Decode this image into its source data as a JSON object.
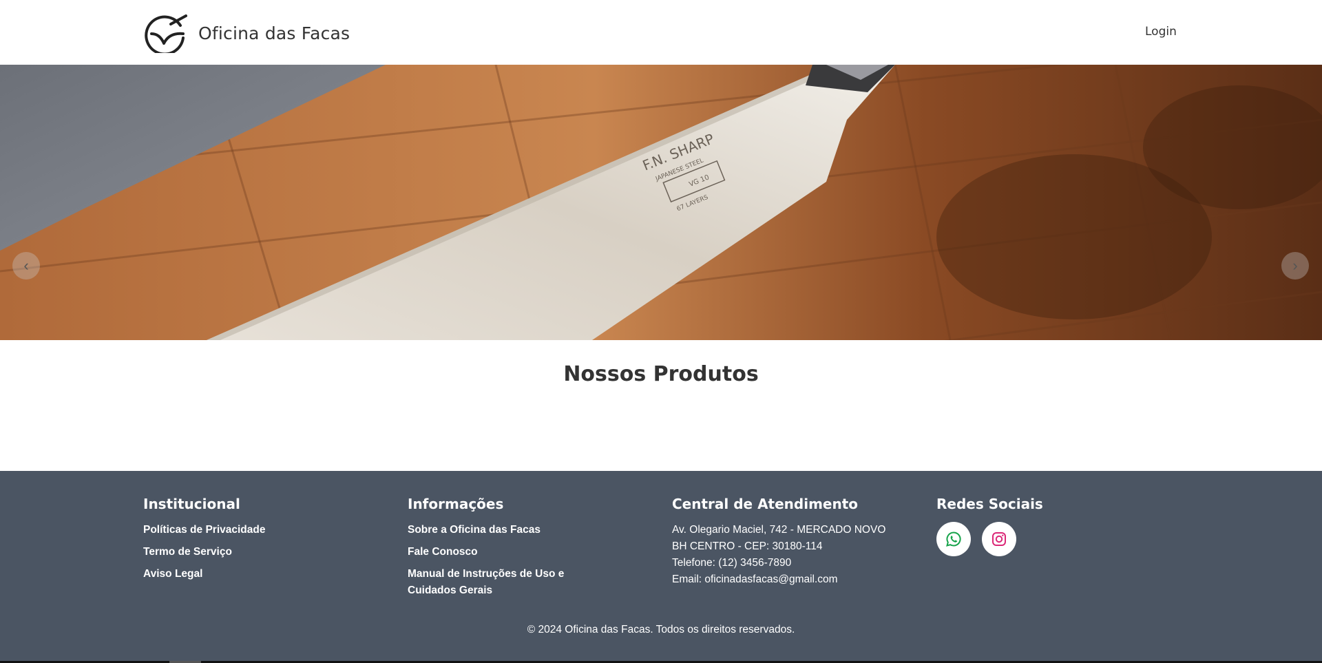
{
  "header": {
    "brand_name": "Oficina das Facas",
    "logo_icon": "knife-logo-icon",
    "login_label": "Login"
  },
  "hero": {
    "prev_icon": "chevron-left-icon",
    "next_icon": "chevron-right-icon",
    "prev_glyph": "‹",
    "next_glyph": "›",
    "knife_engraving": {
      "brand": "F.N. SHARP",
      "line1": "JAPANESE STEEL",
      "line2": "VG 10",
      "line3": "67 LAYERS"
    }
  },
  "main": {
    "products_title": "Nossos Produtos"
  },
  "footer": {
    "institucional": {
      "title": "Institucional",
      "links": [
        "Políticas de Privacidade",
        "Termo de Serviço",
        "Aviso Legal"
      ]
    },
    "informacoes": {
      "title": "Informações",
      "links": [
        "Sobre a Oficina das Facas",
        "Fale Conosco",
        "Manual de Instruções de Uso e Cuidados Gerais"
      ]
    },
    "atendimento": {
      "title": "Central de Atendimento",
      "address1": "Av. Olegario Maciel, 742 - MERCADO NOVO",
      "address2": "BH CENTRO - CEP: 30180-114",
      "phone": "Telefone: (12) 3456-7890",
      "email": "Email: oficinadasfacas@gmail.com"
    },
    "redes": {
      "title": "Redes Sociais",
      "whatsapp_icon": "whatsapp-icon",
      "instagram_icon": "instagram-icon",
      "whatsapp_color": "#16a34a",
      "instagram_color": "#db2777"
    },
    "copyright": "© 2024 Oficina das Facas. Todos os direitos reservados."
  },
  "colors": {
    "footer_bg": "#4b5563",
    "text_dark": "#333333"
  }
}
